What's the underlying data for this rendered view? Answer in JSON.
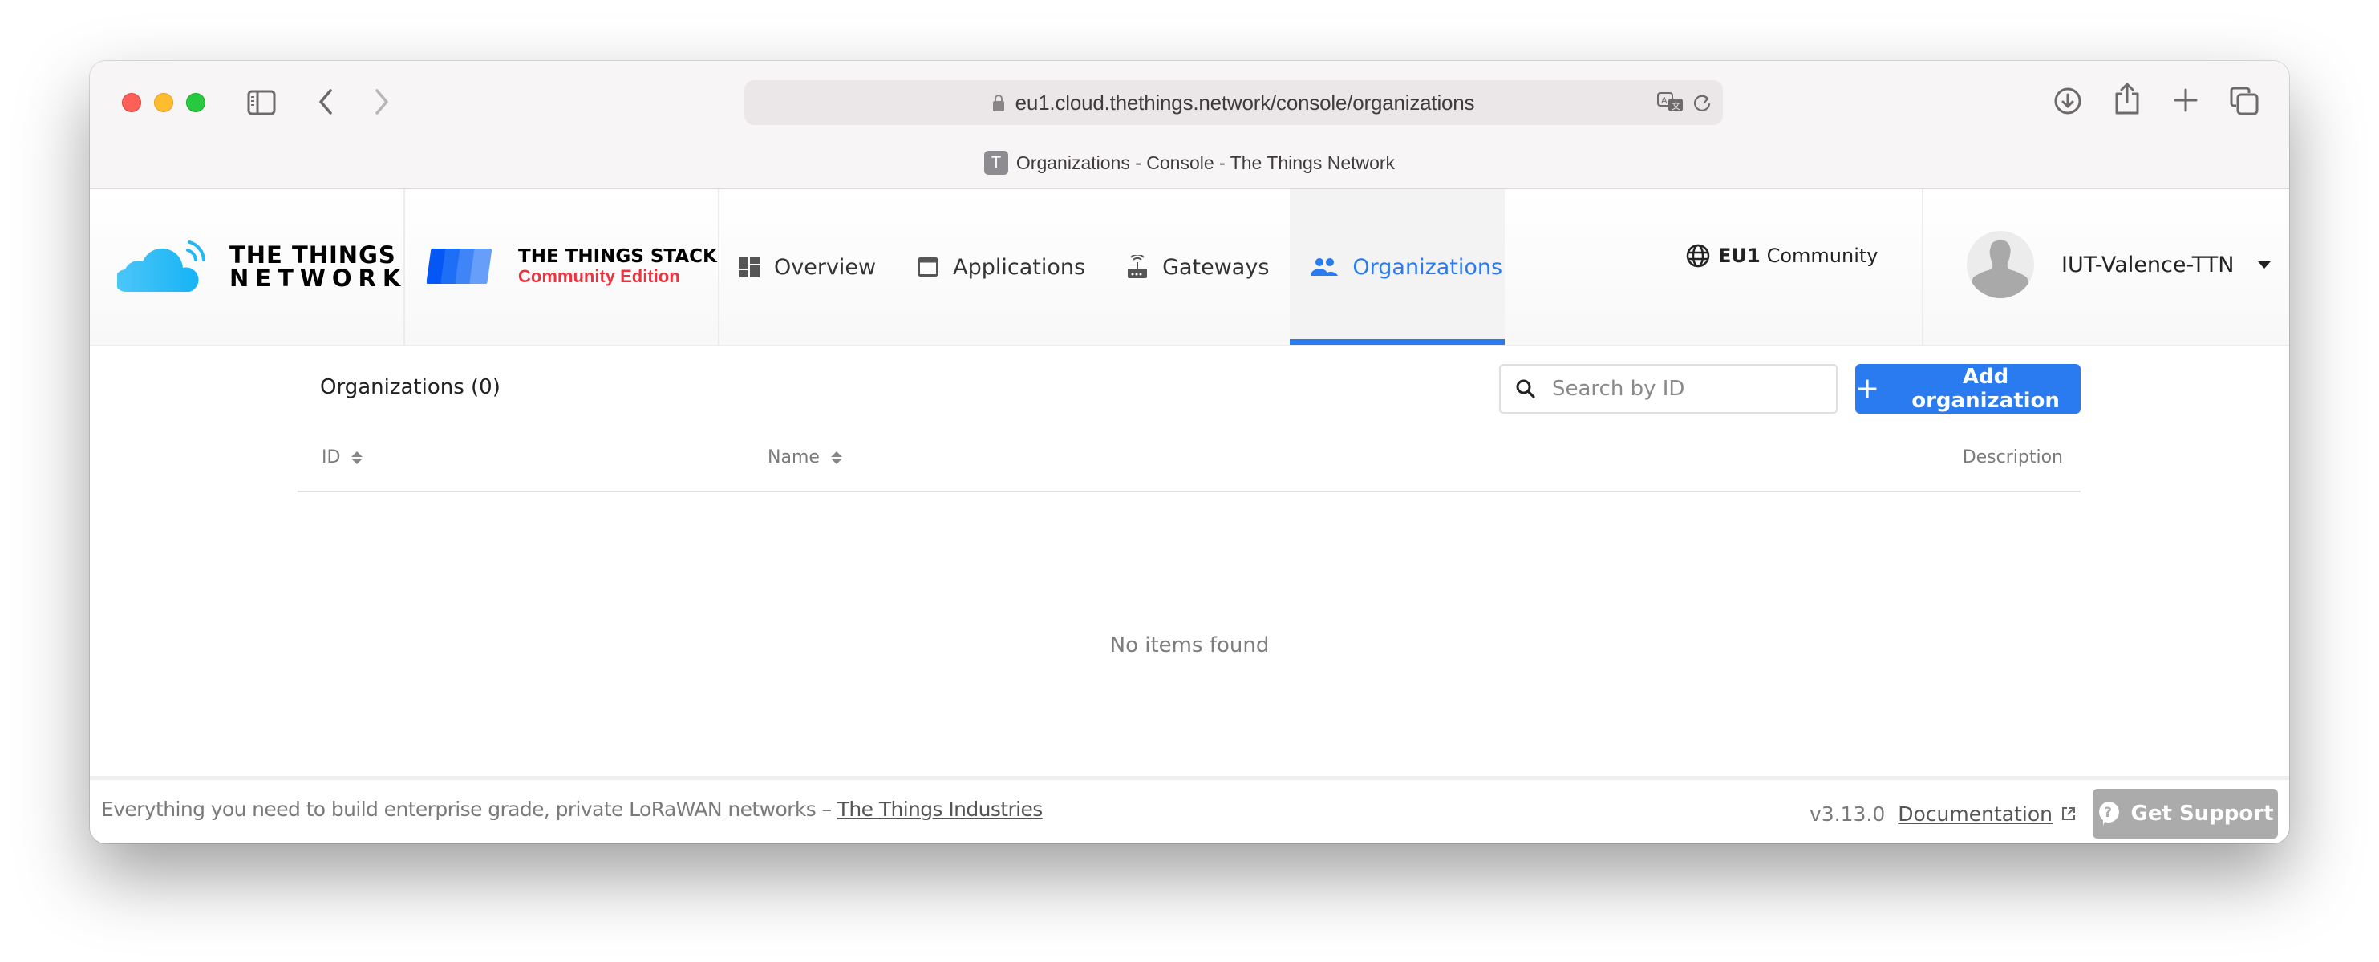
{
  "browser": {
    "url": "eu1.cloud.thethings.network/console/organizations",
    "tab_title": "Organizations - Console - The Things Network",
    "tab_favicon_letter": "T",
    "traffic_lights": {
      "close": "#fe5f57",
      "minimize": "#febc2e",
      "zoom": "#28c840"
    },
    "toolbar_icons": [
      "sidebar-toggle-icon",
      "back-icon",
      "forward-icon",
      "lock-icon",
      "translate-icon",
      "reload-icon",
      "download-icon",
      "share-icon",
      "new-tab-icon",
      "tab-overview-icon"
    ]
  },
  "header": {
    "ttn_logo": {
      "line1": "THE THINGS",
      "line2": "NETWORK"
    },
    "tts_logo": {
      "line1": "THE THINGS STACK",
      "line2": "Community Edition"
    },
    "nav": [
      {
        "label": "Overview",
        "icon": "dashboard-icon",
        "active": false
      },
      {
        "label": "Applications",
        "icon": "window-icon",
        "active": false
      },
      {
        "label": "Gateways",
        "icon": "router-icon",
        "active": false
      },
      {
        "label": "Organizations",
        "icon": "people-icon",
        "active": true
      }
    ],
    "cluster": {
      "code": "EU1",
      "label": "Community"
    },
    "user": {
      "name": "IUT-Valence-TTN"
    }
  },
  "main": {
    "heading": "Organizations (0)",
    "search": {
      "placeholder": "Search by ID",
      "value": ""
    },
    "add_button": "Add organization",
    "table": {
      "columns": [
        {
          "label": "ID",
          "sortable": true
        },
        {
          "label": "Name",
          "sortable": true
        },
        {
          "label": "Description",
          "sortable": false
        }
      ],
      "rows": [],
      "empty_message": "No items found"
    }
  },
  "footer": {
    "tagline": "Everything you need to build enterprise grade, private LoRaWAN networks – ",
    "tagline_link": "The Things Industries",
    "version": "v3.13.0",
    "documentation": "Documentation",
    "support_button": "Get Support"
  },
  "colors": {
    "accent": "#2b7bf0",
    "tts_red": "#ee3340",
    "support_button": "#ababab"
  }
}
